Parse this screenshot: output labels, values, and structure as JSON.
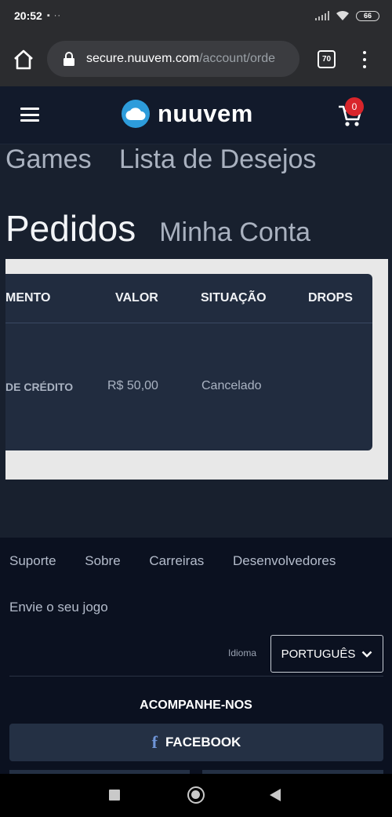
{
  "status_bar": {
    "time": "20:52",
    "left_icons": "▪ ··",
    "battery": "66"
  },
  "browser": {
    "url_host": "secure.nuuvem.com",
    "url_path": "/account/orde",
    "tab_count": "70"
  },
  "header": {
    "brand": "nuuvem",
    "cart_count": "0"
  },
  "account_nav": {
    "games": "Games",
    "wishlist": "Lista de Desejos",
    "orders": "Pedidos",
    "account": "Minha Conta"
  },
  "orders_table": {
    "columns": [
      "MENTO",
      "VALOR",
      "SITUAÇÃO",
      "DROPS"
    ],
    "rows": [
      {
        "payment": "DE CRÉDITO",
        "value": "R$ 50,00",
        "status": "Cancelado",
        "drops": ""
      }
    ]
  },
  "footer": {
    "links": [
      "Suporte",
      "Sobre",
      "Carreiras",
      "Desenvolvedores"
    ],
    "link_submit": "Envie o seu jogo",
    "language_label": "Idioma",
    "language_value": "PORTUGUÊS",
    "follow_title": "ACOMPANHE-NOS",
    "facebook": "FACEBOOK"
  },
  "colors": {
    "brand_blue": "#2d9cdb",
    "badge_red": "#d9252b",
    "page_bg": "#18202e",
    "table_bg": "#212c3f",
    "footer_bg": "#0b1120"
  },
  "icons": [
    "home-icon",
    "lock-icon",
    "tabs-icon",
    "menu-kebab-icon",
    "hamburger-icon",
    "cloud-logo-icon",
    "cart-icon",
    "chevron-down-icon",
    "facebook-icon"
  ]
}
